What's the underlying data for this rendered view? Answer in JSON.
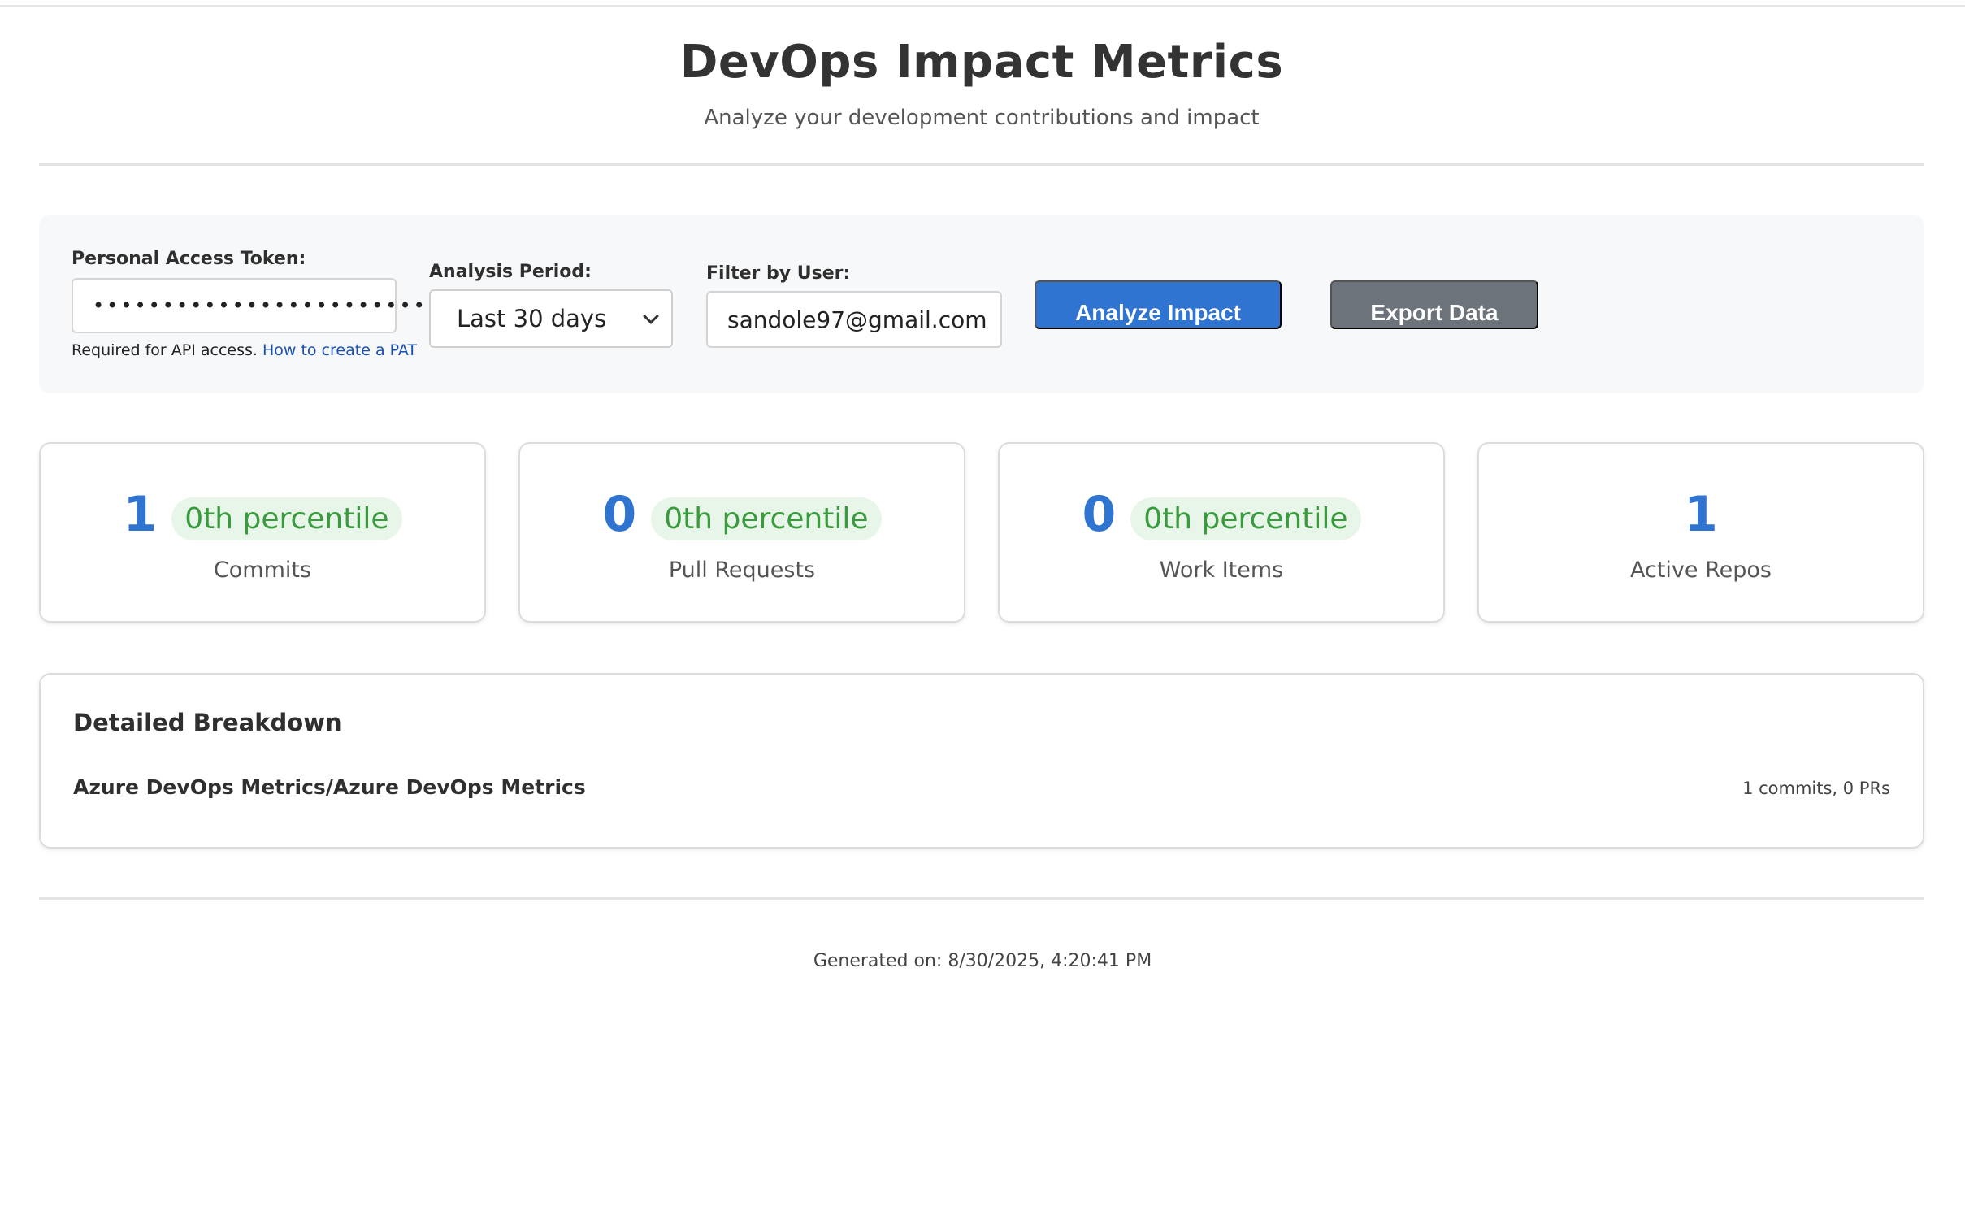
{
  "header": {
    "title": "DevOps Impact Metrics",
    "subtitle": "Analyze your development contributions and impact"
  },
  "controls": {
    "pat": {
      "label": "Personal Access Token:",
      "masked_value": "•••••••••••••••••••••••••••",
      "help_text": "Required for API access.",
      "help_link": "How to create a PAT"
    },
    "period": {
      "label": "Analysis Period:",
      "selected": "Last 30 days"
    },
    "user_filter": {
      "label": "Filter by User:",
      "value": "sandole97@gmail.com"
    },
    "analyze_button": "Analyze Impact",
    "export_button": "Export Data"
  },
  "metrics": [
    {
      "value": "1",
      "percentile": "0th percentile",
      "label": "Commits"
    },
    {
      "value": "0",
      "percentile": "0th percentile",
      "label": "Pull Requests"
    },
    {
      "value": "0",
      "percentile": "0th percentile",
      "label": "Work Items"
    },
    {
      "value": "1",
      "label": "Active Repos"
    }
  ],
  "breakdown": {
    "title": "Detailed Breakdown",
    "items": [
      {
        "repo": "Azure DevOps Metrics/Azure DevOps Metrics",
        "stats": "1 commits, 0 PRs"
      }
    ]
  },
  "footer": {
    "generated": "Generated on: 8/30/2025, 4:20:41 PM"
  },
  "colors": {
    "accent": "#2f74d0",
    "secondary_button": "#6c737a",
    "percentile_text": "#3a9a3e",
    "percentile_bg": "#e8f5e9",
    "panel_bg": "#f7f8fa"
  }
}
